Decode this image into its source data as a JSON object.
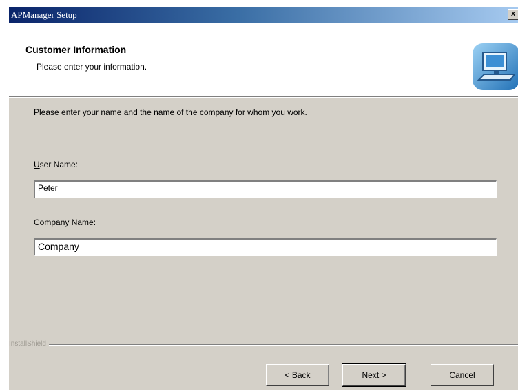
{
  "window": {
    "title": "APManager Setup",
    "close_label": "x"
  },
  "header": {
    "title": "Customer Information",
    "subtitle": "Please enter your information."
  },
  "intro": "Please enter your name and the name of the company for whom you work.",
  "user_name": {
    "label_accel": "U",
    "label_rest": "ser Name:",
    "value": "Peter"
  },
  "company_name": {
    "label_accel": "C",
    "label_rest": "ompany Name:",
    "value": "Company"
  },
  "installshield": "InstallShield",
  "buttons": {
    "back_prefix": "< ",
    "back_accel": "B",
    "back_rest": "ack",
    "next_accel": "N",
    "next_rest": "ext >",
    "cancel": "Cancel"
  },
  "colors": {
    "dialog_bg": "#d4d0c8",
    "title_start": "#0a246a",
    "title_end": "#a6caf0"
  },
  "icons": {
    "header": "computer-setup-icon",
    "close": "close-icon"
  }
}
